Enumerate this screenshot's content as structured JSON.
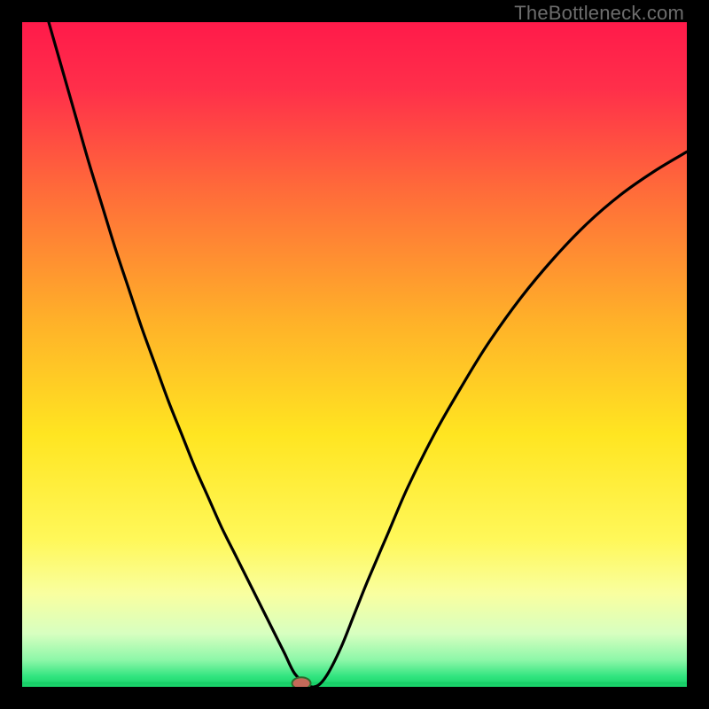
{
  "watermark": "TheBottleneck.com",
  "colors": {
    "frame": "#000000",
    "curve": "#000000",
    "marker_fill": "#c46a59",
    "marker_stroke": "#2e6b2e",
    "baseline": "#18cf68",
    "gradient_stops": [
      {
        "offset": 0.0,
        "color": "#ff1a4a"
      },
      {
        "offset": 0.1,
        "color": "#ff2f4a"
      },
      {
        "offset": 0.25,
        "color": "#ff6a3a"
      },
      {
        "offset": 0.45,
        "color": "#ffb129"
      },
      {
        "offset": 0.62,
        "color": "#ffe521"
      },
      {
        "offset": 0.78,
        "color": "#fff85a"
      },
      {
        "offset": 0.86,
        "color": "#f9ffa0"
      },
      {
        "offset": 0.92,
        "color": "#d7ffc0"
      },
      {
        "offset": 0.96,
        "color": "#8cf7a8"
      },
      {
        "offset": 0.985,
        "color": "#2fe47e"
      },
      {
        "offset": 1.0,
        "color": "#18cf68"
      }
    ]
  },
  "chart_data": {
    "type": "line",
    "title": "",
    "xlabel": "",
    "ylabel": "",
    "xlim": [
      0,
      100
    ],
    "ylim": [
      0,
      100
    ],
    "grid": false,
    "baseline_y": 0,
    "marker": {
      "x": 42,
      "y": 0,
      "rx": 1.4,
      "ry": 0.9
    },
    "series": [
      {
        "name": "bottleneck-curve",
        "x": [
          4,
          6,
          8,
          10,
          12,
          14,
          16,
          18,
          20,
          22,
          24,
          26,
          28,
          30,
          32,
          34,
          36,
          38,
          39.5,
          41,
          43,
          44.5,
          46,
          48,
          50,
          52,
          55,
          58,
          62,
          66,
          70,
          75,
          80,
          85,
          90,
          95,
          100
        ],
        "y": [
          100,
          93,
          86,
          79,
          72.5,
          66,
          60,
          54,
          48.5,
          43,
          38,
          33,
          28.5,
          24,
          20,
          16,
          12,
          8,
          5,
          2,
          0.2,
          0.2,
          2,
          6,
          11,
          16,
          23,
          30,
          38,
          45,
          51.5,
          58.5,
          64.5,
          69.7,
          74,
          77.5,
          80.5
        ]
      }
    ]
  }
}
